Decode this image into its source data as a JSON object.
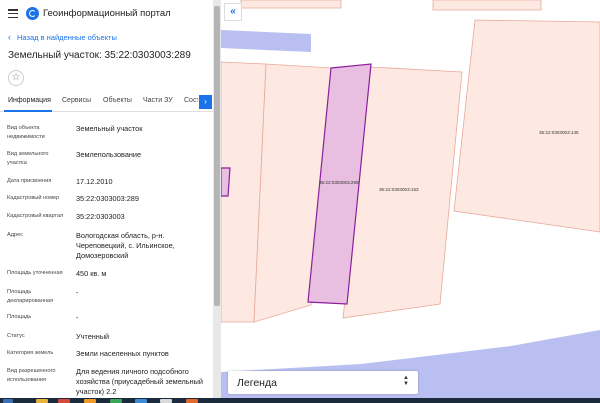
{
  "app": {
    "title": "Геоинформационный портал"
  },
  "nav": {
    "back_label": "Назад в найденные объекты"
  },
  "object": {
    "title": "Земельный участок: 35:22:0303003:289"
  },
  "tabs": [
    {
      "label": "Информация"
    },
    {
      "label": "Сервисы"
    },
    {
      "label": "Объекты"
    },
    {
      "label": "Части ЗУ"
    },
    {
      "label": "Сост"
    }
  ],
  "fields": [
    {
      "label": "Вид объекта недвижимости",
      "value": "Земельный участок"
    },
    {
      "label": "Вид земельного участка",
      "value": "Землепользование"
    },
    {
      "label": "Дата присвоения",
      "value": "17.12.2010"
    },
    {
      "label": "Кадастровый номер",
      "value": "35:22:0303003:289"
    },
    {
      "label": "Кадастровый квартал",
      "value": "35:22:0303003"
    },
    {
      "label": "Адрес",
      "value": "Вологодская область, р-н. Череповецкий, с. Ильинское, Домозеровский"
    },
    {
      "label": "Площадь уточненная",
      "value": "450 кв. м"
    },
    {
      "label": "Площадь декларированная",
      "value": "-"
    },
    {
      "label": "Площадь",
      "value": "-"
    },
    {
      "label": "Статус",
      "value": "Учтенный"
    },
    {
      "label": "Категория земель",
      "value": "Земли населенных пунктов"
    },
    {
      "label": "Вид разрешенного использования",
      "value": "Для ведения личного подсобного хозяйства (приусадебный земельный участок) 2.2"
    }
  ],
  "map": {
    "labels": {
      "selected": "35:22:0303003:289",
      "middle": "35:22:0303003:163",
      "right": "35:22:0303003:145"
    },
    "colors": {
      "parcel_fill": "#fde9e1",
      "parcel_stroke": "#e8a99a",
      "selected_fill": "#e8bfe0",
      "selected_stroke": "#8b1f9c",
      "road_fill": "#b9bff0",
      "accent": "#1a73e8"
    }
  },
  "legend": {
    "label": "Легенда"
  }
}
